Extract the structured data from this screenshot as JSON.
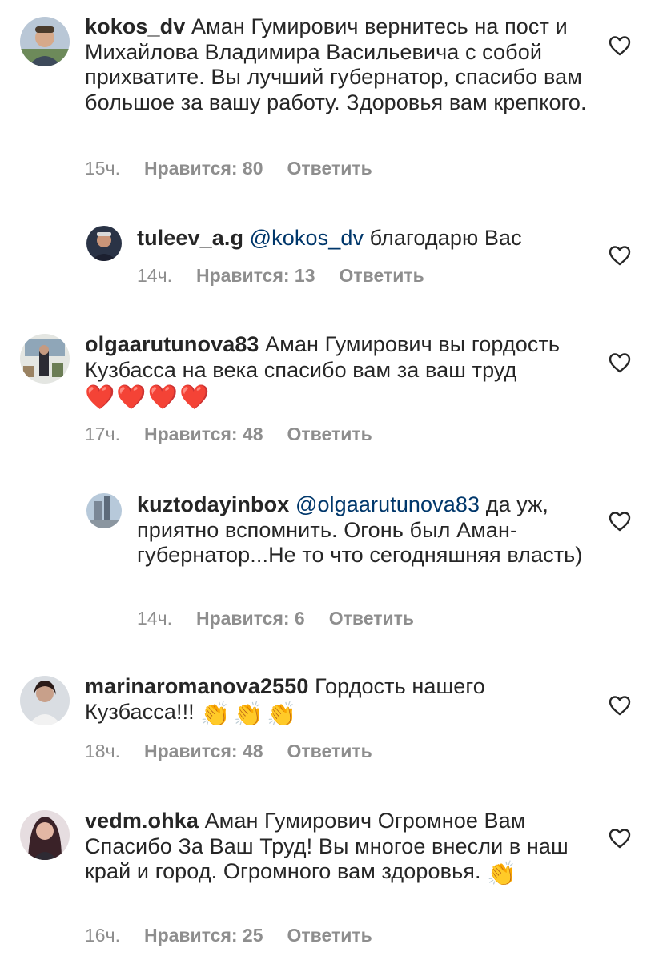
{
  "comments": [
    {
      "username": "kokos_dv",
      "text": "Аман Гумирович вернитесь на пост и Михайлова Владимира Васильевича с собой прихватите. Вы лучший губернатор, спасибо вам большое за вашу работу. Здоровья вам крепкого.",
      "time": "15ч.",
      "likes": "Нравится: 80",
      "reply": "Ответить"
    },
    {
      "username": "tuleev_a.g",
      "mention": "@kokos_dv",
      "text": "благодарю Вас",
      "time": "14ч.",
      "likes": "Нравится: 13",
      "reply": "Ответить"
    },
    {
      "username": "olgaarutunova83",
      "text": "Аман Гумирович вы гордость Кузбасса на века спасибо вам за ваш труд",
      "emoji": "❤️❤️❤️❤️",
      "time": "17ч.",
      "likes": "Нравится: 48",
      "reply": "Ответить"
    },
    {
      "username": "kuztodayinbox",
      "mention": "@olgaarutunova83",
      "text": "да уж, приятно вспомнить. Огонь был Аман-губернатор...Не то что сегодняшняя власть)",
      "time": "14ч.",
      "likes": "Нравится: 6",
      "reply": "Ответить"
    },
    {
      "username": "marinaromanova2550",
      "text": "Гордость нашего Кузбасса!!!",
      "emoji": "👏👏👏",
      "time": "18ч.",
      "likes": "Нравится: 48",
      "reply": "Ответить"
    },
    {
      "username": "vedm.ohka",
      "text": "Аман Гумирович Огромное Вам Спасибо За Ваш Труд! Вы многое внесли в наш край и город. Огромного вам здоровья.",
      "emoji": "👏",
      "time": "16ч.",
      "likes": "Нравится: 25",
      "reply": "Ответить"
    }
  ],
  "icons": {
    "like": "heart-outline-icon"
  },
  "colors": {
    "text": "#262626",
    "meta": "#8e8e8e",
    "mention": "#00376b",
    "heart_emoji": "#e0282e",
    "clap_emoji": "#f6c343"
  }
}
